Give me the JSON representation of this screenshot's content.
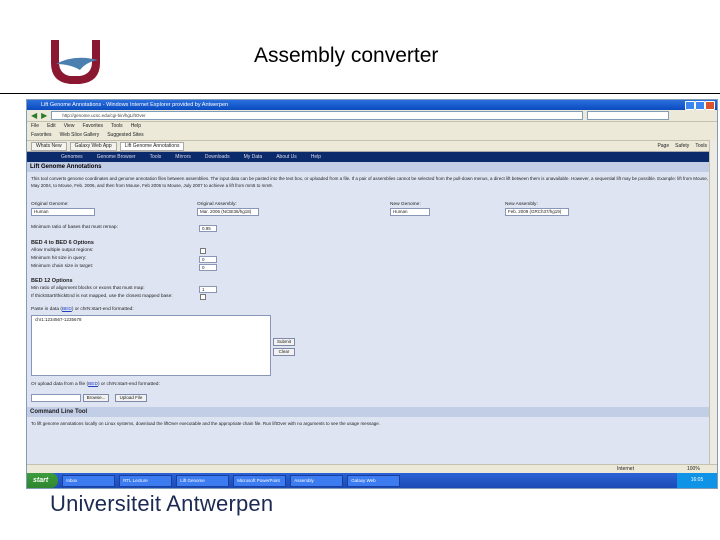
{
  "slide": {
    "title": "Assembly converter",
    "footer": "Universiteit Antwerpen"
  },
  "browser": {
    "window_title": "Lift Genome Annotations - Windows Internet Explorer provided by Antwerpen",
    "url": "http://genome.ucsc.edu/cgi-bin/hgLiftOver",
    "menu": [
      "File",
      "Edit",
      "View",
      "Favorites",
      "Tools",
      "Help"
    ],
    "favorites": [
      "Favorites",
      "Web Slice Gallery",
      "Suggested Sites"
    ],
    "tabs": [
      "Whats New",
      "Galaxy Web App",
      "Lift Genome Annotations"
    ],
    "page_menu": [
      "Page",
      "Safety",
      "Tools"
    ],
    "status": "Internet",
    "zoom": "100%"
  },
  "nav": [
    "Genomes",
    "Genome Browser",
    "Tools",
    "Mirrors",
    "Downloads",
    "My Data",
    "About Us",
    "Help"
  ],
  "liftover": {
    "section_title": "Lift Genome Annotations",
    "intro": "This tool converts genome coordinates and genome annotation files between assemblies. The input data can be pasted into the text box, or uploaded from a file. If a pair of assemblies cannot be selected from the pull-down menus, a direct lift between them is unavailable. However, a sequential lift may be possible. Example: lift from Mouse, May 2004, to Mouse, Feb. 2006, and then from Mouse, Feb 2006 to Mouse, July 2007 to achieve a lift from mm5 to mm9.",
    "original_genome_label": "Original Genome:",
    "original_genome": "Human",
    "original_assembly_label": "Original Assembly:",
    "original_assembly": "Mar. 2006 (NCBI36/hg18)",
    "new_genome_label": "New Genome:",
    "new_genome": "Human",
    "new_assembly_label": "New Assembly:",
    "new_assembly": "Feb. 2009 (GRCh37/hg19)",
    "min_ratio_label": "Minimum ratio of bases that must remap:",
    "min_ratio": "0.95",
    "bed4_header": "BED 4 to BED 6 Options",
    "allow_multiple_label": "Allow multiple output regions:",
    "min_hit_label": "Minimum hit size in query:",
    "min_hit": "0",
    "min_chain_label": "Minimum chain size in target:",
    "min_chain": "0",
    "bed12_header": "BED 12 Options",
    "min_ratio_exon_label": "Min ratio of alignment blocks or exons that must map:",
    "min_ratio_exon": "1",
    "thickstart_label": "If thickStart/thickEnd is not mapped, use the closest mapped base:",
    "paste_label": "Paste in data",
    "paste_link": "BED",
    "paste_suffix": "or chrN:start-end formatted:",
    "textarea_value": "chr1:1234567-1235678",
    "submit": "Submit",
    "clear": "Clear",
    "upload_label": "Or upload data from a file",
    "upload_link": "BED",
    "upload_suffix": "or chrN:start-end formatted:",
    "browse": "Browse...",
    "upload_btn": "Upload File",
    "cmd_header": "Command Line Tool",
    "cmd_text": "To lift genome annotations locally on Linux systems, download the liftOver executable and the appropriate chain file. Run liftOver with no arguments to see the usage message."
  },
  "taskbar": {
    "start": "start",
    "items": [
      "Inbox",
      "RTL Lecture",
      "Lift Genome",
      "Microsoft PowerPoint",
      "Assembly",
      "Galaxy Web"
    ],
    "clock": "16:05"
  }
}
